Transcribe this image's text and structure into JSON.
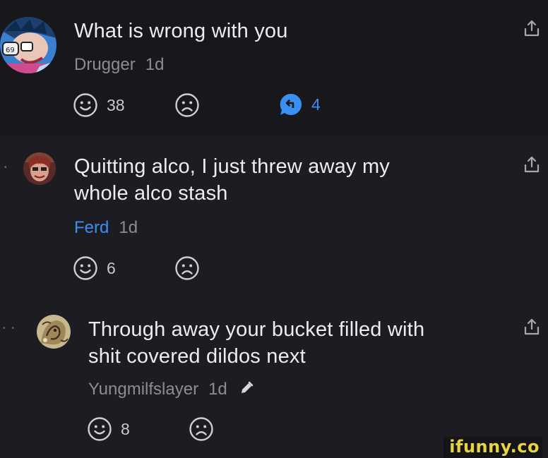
{
  "comments": [
    {
      "text": "What is wrong with you",
      "author": "Drugger",
      "time": "1d",
      "smile_count": "38",
      "reply_count": "4",
      "avatar_icon": "cartoon-character-avatar",
      "share_icon": "share-icon"
    },
    {
      "text_line1": "Quitting alco, I just threw away my",
      "text_line2": "whole alco stash",
      "author": "Ferd",
      "time": "1d",
      "smile_count": "6",
      "avatar_icon": "person-avatar",
      "share_icon": "share-icon"
    },
    {
      "text_line1": "Through away your bucket filled with",
      "text_line2": "shit covered dildos next",
      "author": "Yungmilfslayer",
      "time": "1d",
      "smile_count": "8",
      "avatar_icon": "dragon-avatar",
      "edit_icon": "pencil-icon",
      "share_icon": "share-icon"
    }
  ],
  "colors": {
    "background": "#1d1c22",
    "highlight_background": "#18171c",
    "accent_blue": "#3b8ff0",
    "muted_text": "#8d8c93",
    "watermark": "#e8d443"
  },
  "watermark": {
    "text": "ifunny.co"
  }
}
